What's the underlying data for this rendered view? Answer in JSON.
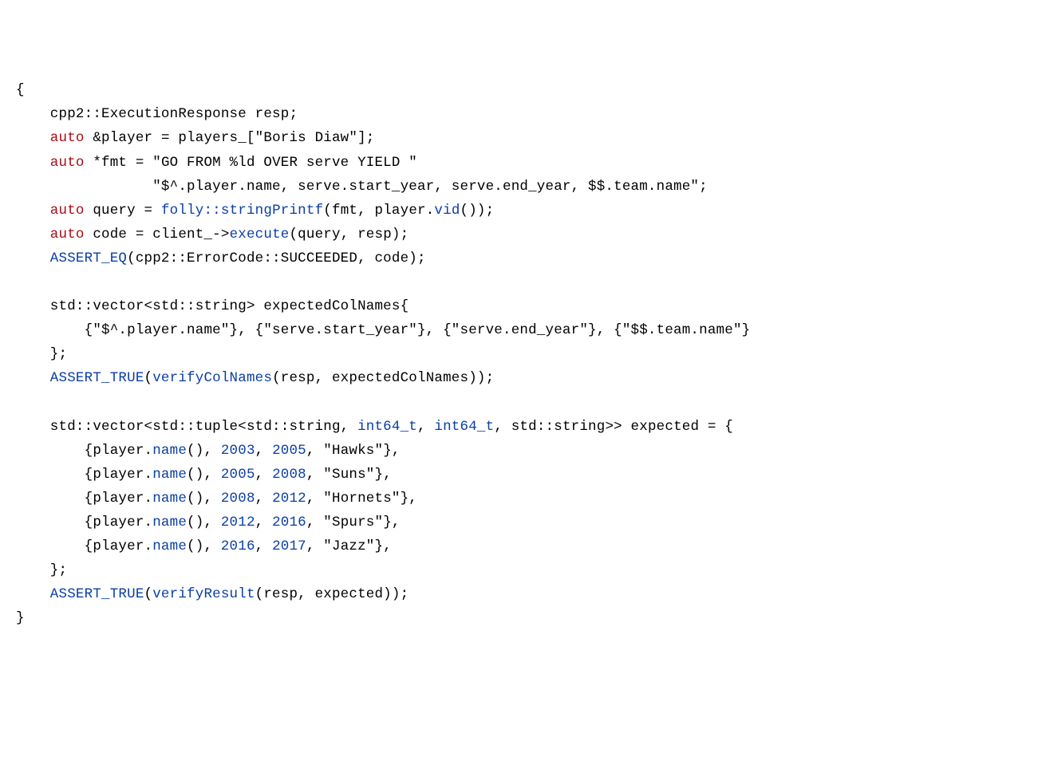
{
  "code": {
    "l1": "{",
    "l2_a": "    cpp2::ExecutionResponse resp;",
    "l3_kw": "    auto",
    "l3_b": " &player = players_[\"Boris Diaw\"];",
    "l4_kw": "    auto",
    "l4_b": " *fmt = \"GO FROM %ld OVER serve YIELD \"",
    "l5_a": "                \"$^.player.name, serve.start_year, serve.end_year, $$.team.name\";",
    "l6_kw": "    auto",
    "l6_b": " query = ",
    "l6_fn": "folly::stringPrintf",
    "l6_c": "(fmt, player.",
    "l6_fn2": "vid",
    "l6_d": "());",
    "l7_kw": "    auto",
    "l7_b": " code = client_->",
    "l7_fn": "execute",
    "l7_c": "(query, resp);",
    "l8_fn": "    ASSERT_EQ",
    "l8_b": "(cpp2::ErrorCode::SUCCEEDED, code);",
    "l9": "",
    "l10_a": "    std::vector<std::string> expectedColNames{",
    "l11_a": "        {\"$^.player.name\"}, {\"serve.start_year\"}, {\"serve.end_year\"}, {\"$$.team.name\"}",
    "l12_a": "    };",
    "l13_fn": "    ASSERT_TRUE",
    "l13_b": "(",
    "l13_fn2": "verifyColNames",
    "l13_c": "(resp, expectedColNames));",
    "l14": "",
    "l15_a": "    std::vector<std::tuple<std::string, ",
    "l15_t1": "int64_t",
    "l15_b": ", ",
    "l15_t2": "int64_t",
    "l15_c": ", std::string>> expected = {",
    "r_pre_a": "        {player.",
    "r_name": "name",
    "r_pre_b": "(), ",
    "r_sep": ", ",
    "rows": [
      {
        "y1": "2003",
        "y2": "2005",
        "team": "\"Hawks\"},"
      },
      {
        "y1": "2005",
        "y2": "2008",
        "team": "\"Suns\"},"
      },
      {
        "y1": "2008",
        "y2": "2012",
        "team": "\"Hornets\"},"
      },
      {
        "y1": "2012",
        "y2": "2016",
        "team": "\"Spurs\"},"
      },
      {
        "y1": "2016",
        "y2": "2017",
        "team": "\"Jazz\"},"
      }
    ],
    "l21_a": "    };",
    "l22_fn": "    ASSERT_TRUE",
    "l22_b": "(",
    "l22_fn2": "verifyResult",
    "l22_c": "(resp, expected));",
    "l23": "}"
  }
}
